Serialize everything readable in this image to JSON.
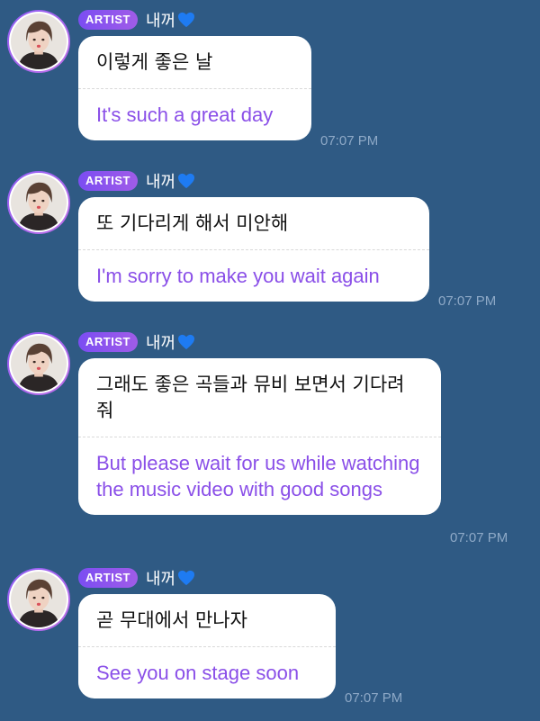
{
  "colors": {
    "background": "#2f5a84",
    "bubble": "#ffffff",
    "korean_text": "#111111",
    "english_text": "#8a4fe8",
    "badge": "#7b4df2",
    "timestamp": "#8ea9c7",
    "heart": "#1e7bf2"
  },
  "messages": [
    {
      "badge": "ARTIST",
      "sender": "내꺼",
      "heart_icon": "blue-heart-icon",
      "korean": "이렇게 좋은 날",
      "english": "It's such a great day",
      "time": "07:07 PM"
    },
    {
      "badge": "ARTIST",
      "sender": "내꺼",
      "heart_icon": "blue-heart-icon",
      "korean": "또 기다리게 해서 미안해",
      "english": "I'm sorry to make you wait again",
      "time": "07:07 PM"
    },
    {
      "badge": "ARTIST",
      "sender": "내꺼",
      "heart_icon": "blue-heart-icon",
      "korean": "그래도 좋은 곡들과 뮤비 보면서 기다려 줘",
      "english": "But please wait for us while watching the music video with good songs",
      "time": "07:07 PM"
    },
    {
      "badge": "ARTIST",
      "sender": "내꺼",
      "heart_icon": "blue-heart-icon",
      "korean": "곧 무대에서 만나자",
      "english": "See you on stage soon",
      "time": "07:07 PM"
    }
  ]
}
